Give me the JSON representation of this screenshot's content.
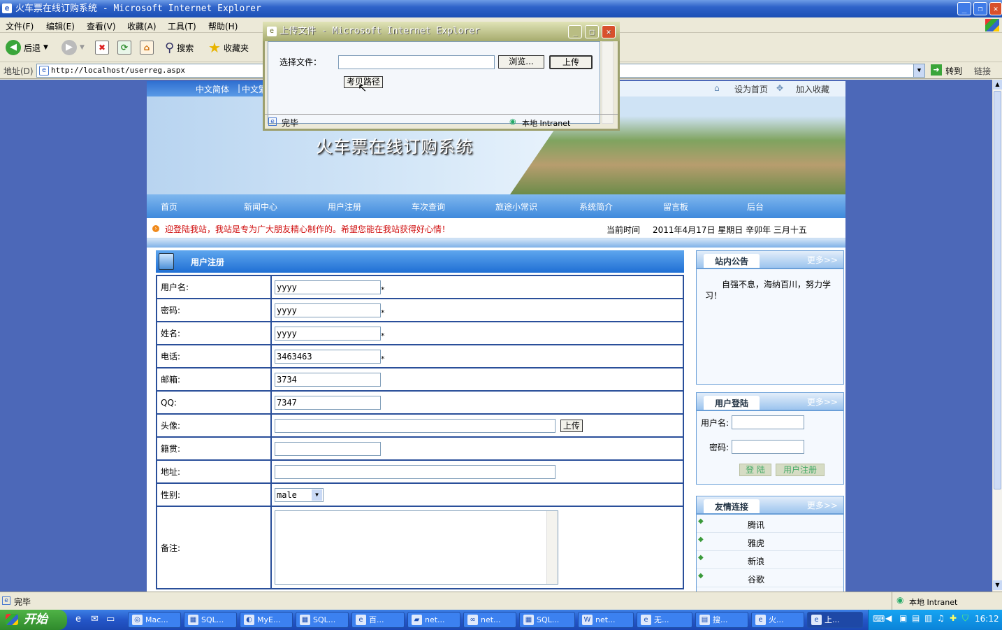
{
  "window": {
    "title": "火车票在线订购系统 - Microsoft Internet Explorer"
  },
  "menu": [
    "文件(F)",
    "编辑(E)",
    "查看(V)",
    "收藏(A)",
    "工具(T)",
    "帮助(H)"
  ],
  "toolbar": {
    "back": "后退",
    "search": "搜索",
    "favorites": "收藏夹"
  },
  "address": {
    "label": "地址(D)",
    "url": "http://localhost/userreg.aspx",
    "go": "转到",
    "links": "链接"
  },
  "site": {
    "lang": {
      "simplified": "中文简体",
      "traditional": "中文繁"
    },
    "top_links": {
      "home": "设为首页",
      "favorite": "加入收藏"
    },
    "banner_title": "火车票在线订购系统",
    "nav": [
      "首页",
      "新闻中心",
      "用户注册",
      "车次查询",
      "旅途小常识",
      "系统简介",
      "留言板",
      "后台"
    ],
    "marquee": "迎登陆我站，我站是专为广大朋友精心制作的。希望您能在我站获得好心情！",
    "time_label": "当前时间",
    "time_value": "2011年4月17日 星期日 辛卯年 三月十五"
  },
  "register": {
    "title": "用户注册",
    "fields": {
      "username": {
        "label": "用户名:",
        "value": "yyyy"
      },
      "password": {
        "label": "密码:",
        "value": "yyyy"
      },
      "name": {
        "label": "姓名:",
        "value": "yyyy"
      },
      "phone": {
        "label": "电话:",
        "value": "3463463"
      },
      "email": {
        "label": "邮箱:",
        "value": "3734"
      },
      "qq": {
        "label": "QQ:",
        "value": "7347"
      },
      "avatar": {
        "label": "头像:",
        "value": "",
        "button": "上传"
      },
      "origin": {
        "label": "籍贯:",
        "value": ""
      },
      "address": {
        "label": "地址:",
        "value": ""
      },
      "gender": {
        "label": "性别:",
        "value": "male"
      },
      "remark": {
        "label": "备注:",
        "value": ""
      }
    },
    "required_mark": "*"
  },
  "sidebar": {
    "announce": {
      "title": "站内公告",
      "more": "更多>>",
      "text": "自强不息，海纳百川，努力学习！"
    },
    "login": {
      "title": "用户登陆",
      "more": "更多>>",
      "user_label": "用户名:",
      "pass_label": "密码:",
      "login_btn": "登 陆",
      "reg_btn": "用户注册"
    },
    "links": {
      "title": "友情连接",
      "more": "更多>>",
      "items": [
        "腾讯",
        "雅虎",
        "新浪",
        "谷歌"
      ]
    }
  },
  "dialog": {
    "title": "上传文件 - Microsoft Internet Explorer",
    "choose_label": "选择文件：",
    "browse": "浏览...",
    "upload": "上传",
    "tooltip": "考贝路径",
    "status_done": "完毕",
    "status_zone": "本地 Intranet"
  },
  "status": {
    "done": "完毕",
    "zone": "本地 Intranet"
  },
  "taskbar": {
    "start": "开始",
    "tasks": [
      "Mac...",
      "SQL...",
      "MyE...",
      "SQL...",
      "百...",
      "net...",
      "net...",
      "SQL...",
      "net...",
      "无...",
      "搜...",
      "火...",
      "上..."
    ],
    "clock": "16:12"
  }
}
